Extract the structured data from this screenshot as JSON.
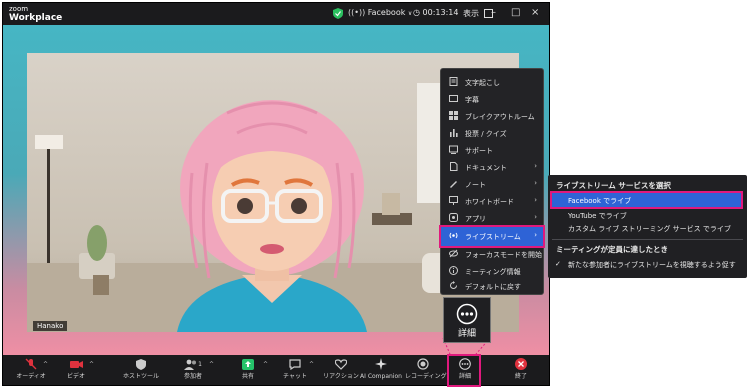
{
  "titlebar": {
    "logo_line1": "zoom",
    "logo_line2": "Workplace",
    "stream_service": "Facebook",
    "stream_caret": "∨",
    "timer": "00:13:14",
    "view_label": "表示",
    "minimize": "–",
    "maximize": "□",
    "close": "×"
  },
  "participant": {
    "name": "Hanako"
  },
  "more_menu": {
    "items": [
      {
        "label": "文字起こし",
        "icon": "document-icon",
        "arrow": ""
      },
      {
        "label": "字幕",
        "icon": "captions-icon",
        "arrow": ""
      },
      {
        "label": "ブレイクアウトルーム",
        "icon": "grid-icon",
        "arrow": ""
      },
      {
        "label": "投票 / クイズ",
        "icon": "chart-icon",
        "arrow": ""
      },
      {
        "label": "サポート",
        "icon": "support-icon",
        "arrow": ""
      },
      {
        "label": "ドキュメント",
        "icon": "doc-icon",
        "arrow": "›"
      },
      {
        "label": "ノート",
        "icon": "note-icon",
        "arrow": "›"
      },
      {
        "label": "ホワイトボード",
        "icon": "whiteboard-icon",
        "arrow": "›"
      },
      {
        "label": "アプリ",
        "icon": "apps-icon",
        "arrow": "›"
      },
      {
        "label": "ライブストリーム",
        "icon": "live-icon",
        "arrow": "›"
      },
      {
        "label": "フォーカスモードを開始",
        "icon": "focus-icon",
        "arrow": ""
      },
      {
        "label": "ミーティング情報",
        "icon": "info-icon",
        "arrow": ""
      },
      {
        "label": "デフォルトに戻す",
        "icon": "reset-icon",
        "arrow": ""
      }
    ]
  },
  "submenu": {
    "heading1": "ライブストリーム サービスを選択",
    "options": [
      "Facebook でライブ",
      "YouTube でライブ",
      "カスタム ライブ ストリーミング サービス でライブ"
    ],
    "heading2": "ミーティングが定員に達したとき",
    "checked_option": "新たな参加者にライブストリームを視聴するよう促す",
    "check_mark": "✓"
  },
  "callout": {
    "label": "詳細"
  },
  "toolbar": {
    "items": [
      {
        "label": "オーディオ"
      },
      {
        "label": "ビデオ"
      },
      {
        "label": "ホストツール"
      },
      {
        "label": "参加者"
      },
      {
        "label": "共有"
      },
      {
        "label": "チャット"
      },
      {
        "label": "リアクション"
      },
      {
        "label": "AI Companion"
      },
      {
        "label": "レコーディング"
      },
      {
        "label": "詳細"
      },
      {
        "label": "終了"
      }
    ],
    "participant_count": "1",
    "caret": "^"
  },
  "colors": {
    "highlight": "#e0197d",
    "selection": "#2e63d6",
    "share_green": "#25c36a",
    "end_red": "#e0323e"
  }
}
